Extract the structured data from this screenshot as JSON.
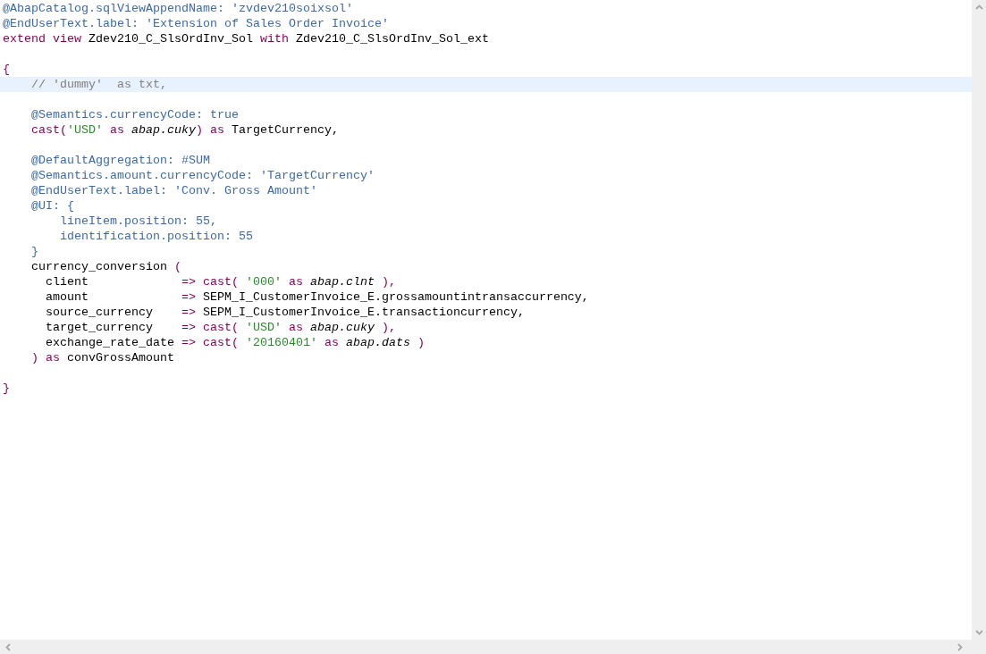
{
  "editor": {
    "lines": [
      {
        "current": false,
        "tokens": [
          {
            "kind": "annotation",
            "text": "@AbapCatalog.sqlViewAppendName: 'zvdev210soixsol'"
          }
        ]
      },
      {
        "current": false,
        "tokens": [
          {
            "kind": "annotation",
            "text": "@EndUserText.label: 'Extension of Sales Order Invoice'"
          }
        ]
      },
      {
        "current": false,
        "tokens": [
          {
            "kind": "keyword",
            "text": "extend view"
          },
          {
            "kind": "plain",
            "text": " Zdev210_C_SlsOrdInv_Sol "
          },
          {
            "kind": "keyword",
            "text": "with"
          },
          {
            "kind": "plain",
            "text": " Zdev210_C_SlsOrdInv_Sol_ext"
          }
        ]
      },
      {
        "current": false
      },
      {
        "current": false,
        "tokens": [
          {
            "kind": "keyword",
            "text": "{"
          }
        ]
      },
      {
        "current": true,
        "tokens": [
          {
            "kind": "comment",
            "text": "    // 'dummy'  as txt,"
          }
        ]
      },
      {
        "current": false
      },
      {
        "current": false,
        "tokens": [
          {
            "kind": "annotation",
            "text": "    @Semantics.currencyCode: true"
          }
        ]
      },
      {
        "current": false,
        "tokens": [
          {
            "kind": "keyword",
            "text": "    cast("
          },
          {
            "kind": "string",
            "text": "'USD'"
          },
          {
            "kind": "keyword",
            "text": " as "
          },
          {
            "kind": "type",
            "text": "abap.cuky"
          },
          {
            "kind": "keyword",
            "text": ") as"
          },
          {
            "kind": "plain",
            "text": " TargetCurrency,"
          }
        ]
      },
      {
        "current": false
      },
      {
        "current": false,
        "tokens": [
          {
            "kind": "annotation",
            "text": "    @DefaultAggregation: #SUM"
          }
        ]
      },
      {
        "current": false,
        "tokens": [
          {
            "kind": "annotation",
            "text": "    @Semantics.amount.currencyCode: 'TargetCurrency'"
          }
        ]
      },
      {
        "current": false,
        "tokens": [
          {
            "kind": "annotation",
            "text": "    @EndUserText.label: 'Conv. Gross Amount'"
          }
        ]
      },
      {
        "current": false,
        "tokens": [
          {
            "kind": "annotation",
            "text": "    @UI: {"
          }
        ]
      },
      {
        "current": false,
        "tokens": [
          {
            "kind": "annotation",
            "text": "        lineItem.position: 55,"
          }
        ]
      },
      {
        "current": false,
        "tokens": [
          {
            "kind": "annotation",
            "text": "        identification.position: 55"
          }
        ]
      },
      {
        "current": false,
        "tokens": [
          {
            "kind": "annotation",
            "text": "    }"
          }
        ]
      },
      {
        "current": false,
        "tokens": [
          {
            "kind": "plain",
            "text": "    currency_conversion "
          },
          {
            "kind": "keyword",
            "text": "("
          }
        ]
      },
      {
        "current": false,
        "tokens": [
          {
            "kind": "plain",
            "text": "      client             "
          },
          {
            "kind": "keyword",
            "text": "=> cast( "
          },
          {
            "kind": "string",
            "text": "'000'"
          },
          {
            "kind": "keyword",
            "text": " as "
          },
          {
            "kind": "type",
            "text": "abap.clnt"
          },
          {
            "kind": "keyword",
            "text": " ),"
          }
        ]
      },
      {
        "current": false,
        "tokens": [
          {
            "kind": "plain",
            "text": "      amount             "
          },
          {
            "kind": "keyword",
            "text": "=>"
          },
          {
            "kind": "plain",
            "text": " SEPM_I_CustomerInvoice_E.grossamountintransaccurrency,"
          }
        ]
      },
      {
        "current": false,
        "tokens": [
          {
            "kind": "plain",
            "text": "      source_currency    "
          },
          {
            "kind": "keyword",
            "text": "=>"
          },
          {
            "kind": "plain",
            "text": " SEPM_I_CustomerInvoice_E.transactioncurrency,"
          }
        ]
      },
      {
        "current": false,
        "tokens": [
          {
            "kind": "plain",
            "text": "      target_currency    "
          },
          {
            "kind": "keyword",
            "text": "=> cast( "
          },
          {
            "kind": "string",
            "text": "'USD'"
          },
          {
            "kind": "keyword",
            "text": " as "
          },
          {
            "kind": "type",
            "text": "abap.cuky"
          },
          {
            "kind": "keyword",
            "text": " ),"
          }
        ]
      },
      {
        "current": false,
        "tokens": [
          {
            "kind": "plain",
            "text": "      exchange_rate_date "
          },
          {
            "kind": "keyword",
            "text": "=> cast( "
          },
          {
            "kind": "string",
            "text": "'20160401'"
          },
          {
            "kind": "keyword",
            "text": " as "
          },
          {
            "kind": "type",
            "text": "abap.dats"
          },
          {
            "kind": "keyword",
            "text": " )"
          }
        ]
      },
      {
        "current": false,
        "tokens": [
          {
            "kind": "keyword",
            "text": "    ) as"
          },
          {
            "kind": "plain",
            "text": " convGrossAmount"
          }
        ]
      },
      {
        "current": false
      },
      {
        "current": false,
        "tokens": [
          {
            "kind": "keyword",
            "text": "}"
          }
        ]
      }
    ]
  }
}
